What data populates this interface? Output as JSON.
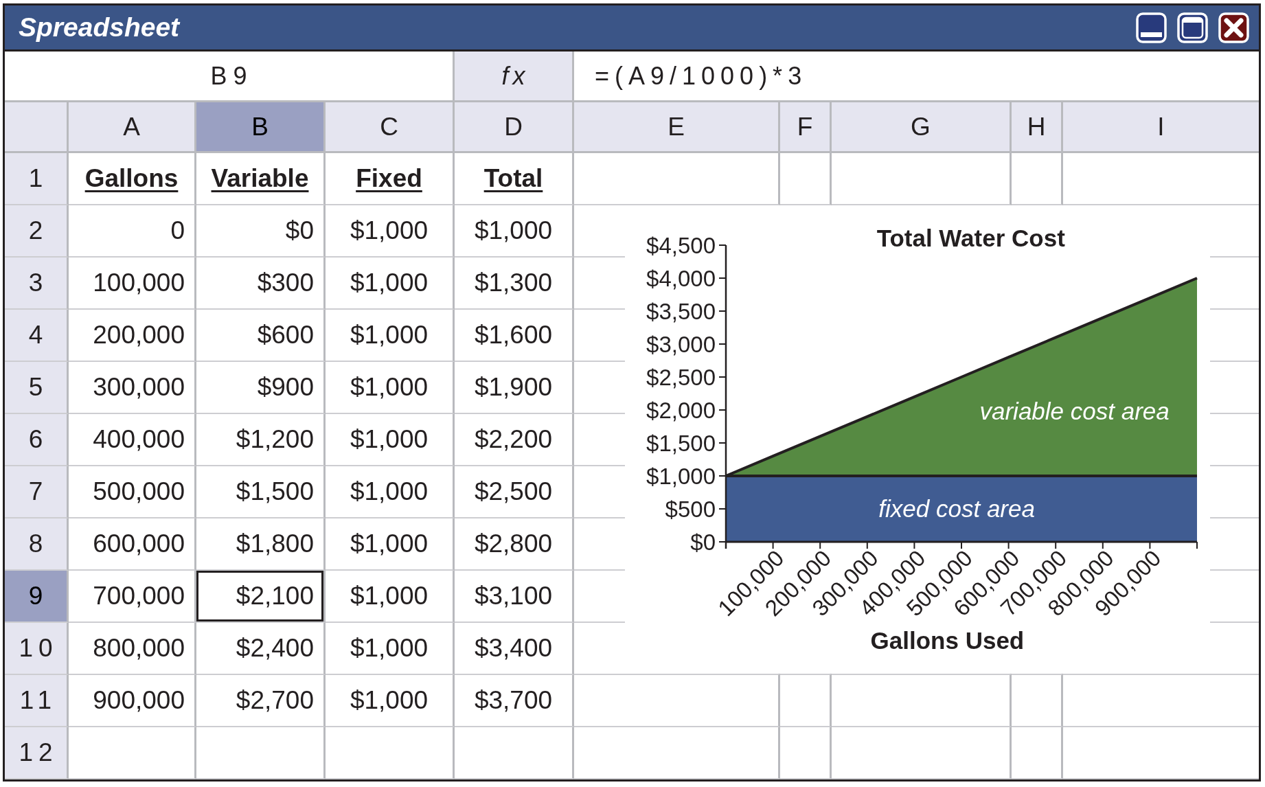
{
  "window": {
    "title": "Spreadsheet",
    "controls": [
      {
        "kind": "minimize"
      },
      {
        "kind": "maximize"
      },
      {
        "kind": "close"
      }
    ]
  },
  "formula_bar": {
    "cell_reference": "B9",
    "function_button": "fx",
    "formula": "=(A9/1000)*3"
  },
  "columns": [
    {
      "label": "A",
      "selected": false
    },
    {
      "label": "B",
      "selected": true
    },
    {
      "label": "C",
      "selected": false
    },
    {
      "label": "D",
      "selected": false
    },
    {
      "label": "E",
      "selected": false
    },
    {
      "label": "F",
      "selected": false
    },
    {
      "label": "G",
      "selected": false
    },
    {
      "label": "H",
      "selected": false
    },
    {
      "label": "I",
      "selected": false
    }
  ],
  "rows": [
    {
      "label": "1",
      "selected": false,
      "kind": "heading",
      "cells": [
        {
          "text": "Gallons",
          "selected": false
        },
        {
          "text": "Variable",
          "selected": false
        },
        {
          "text": "Fixed",
          "selected": false
        },
        {
          "text": "Total",
          "selected": false
        }
      ]
    },
    {
      "label": "2",
      "selected": false,
      "kind": "data",
      "cells": [
        {
          "text": "0",
          "selected": false
        },
        {
          "text": "$0",
          "selected": false
        },
        {
          "text": "$1,000",
          "selected": false
        },
        {
          "text": "$1,000",
          "selected": false
        }
      ]
    },
    {
      "label": "3",
      "selected": false,
      "kind": "data",
      "cells": [
        {
          "text": "100,000",
          "selected": false
        },
        {
          "text": "$300",
          "selected": false
        },
        {
          "text": "$1,000",
          "selected": false
        },
        {
          "text": "$1,300",
          "selected": false
        }
      ]
    },
    {
      "label": "4",
      "selected": false,
      "kind": "data",
      "cells": [
        {
          "text": "200,000",
          "selected": false
        },
        {
          "text": "$600",
          "selected": false
        },
        {
          "text": "$1,000",
          "selected": false
        },
        {
          "text": "$1,600",
          "selected": false
        }
      ]
    },
    {
      "label": "5",
      "selected": false,
      "kind": "data",
      "cells": [
        {
          "text": "300,000",
          "selected": false
        },
        {
          "text": "$900",
          "selected": false
        },
        {
          "text": "$1,000",
          "selected": false
        },
        {
          "text": "$1,900",
          "selected": false
        }
      ]
    },
    {
      "label": "6",
      "selected": false,
      "kind": "data",
      "cells": [
        {
          "text": "400,000",
          "selected": false
        },
        {
          "text": "$1,200",
          "selected": false
        },
        {
          "text": "$1,000",
          "selected": false
        },
        {
          "text": "$2,200",
          "selected": false
        }
      ]
    },
    {
      "label": "7",
      "selected": false,
      "kind": "data",
      "cells": [
        {
          "text": "500,000",
          "selected": false
        },
        {
          "text": "$1,500",
          "selected": false
        },
        {
          "text": "$1,000",
          "selected": false
        },
        {
          "text": "$2,500",
          "selected": false
        }
      ]
    },
    {
      "label": "8",
      "selected": false,
      "kind": "data",
      "cells": [
        {
          "text": "600,000",
          "selected": false
        },
        {
          "text": "$1,800",
          "selected": false
        },
        {
          "text": "$1,000",
          "selected": false
        },
        {
          "text": "$2,800",
          "selected": false
        }
      ]
    },
    {
      "label": "9",
      "selected": true,
      "kind": "data",
      "cells": [
        {
          "text": "700,000",
          "selected": false
        },
        {
          "text": "$2,100",
          "selected": true
        },
        {
          "text": "$1,000",
          "selected": false
        },
        {
          "text": "$3,100",
          "selected": false
        }
      ]
    },
    {
      "label": "10",
      "selected": false,
      "kind": "data",
      "cells": [
        {
          "text": "800,000",
          "selected": false
        },
        {
          "text": "$2,400",
          "selected": false
        },
        {
          "text": "$1,000",
          "selected": false
        },
        {
          "text": "$3,400",
          "selected": false
        }
      ]
    },
    {
      "label": "11",
      "selected": false,
      "kind": "data",
      "cells": [
        {
          "text": "900,000",
          "selected": false
        },
        {
          "text": "$2,700",
          "selected": false
        },
        {
          "text": "$1,000",
          "selected": false
        },
        {
          "text": "$3,700",
          "selected": false
        }
      ]
    },
    {
      "label": "12",
      "selected": false
    }
  ],
  "chart": {
    "chart_data": {
      "type": "area",
      "title": "Total Water Cost",
      "xlabel": "Gallons Used",
      "x": [
        0,
        100000,
        200000,
        300000,
        400000,
        500000,
        600000,
        700000,
        800000,
        900000,
        1000000
      ],
      "series": [
        {
          "color": "#405c92",
          "values": [
            1000,
            1000,
            1000,
            1000,
            1000,
            1000,
            1000,
            1000,
            1000,
            1000,
            1000
          ]
        },
        {
          "color": "#568a42",
          "values": [
            0,
            300,
            600,
            900,
            1200,
            1500,
            1800,
            2100,
            2400,
            2700,
            3000
          ]
        }
      ],
      "stacked": true,
      "xlim": [
        0,
        1000000
      ],
      "ylim": [
        0,
        4500
      ],
      "xticks": [
        {
          "value": 100000,
          "label": "100,000"
        },
        {
          "value": 200000,
          "label": "200,000"
        },
        {
          "value": 300000,
          "label": "300,000"
        },
        {
          "value": 400000,
          "label": "400,000"
        },
        {
          "value": 500000,
          "label": "500,000"
        },
        {
          "value": 600000,
          "label": "600,000"
        },
        {
          "value": 700000,
          "label": "700,000"
        },
        {
          "value": 800000,
          "label": "800,000"
        },
        {
          "value": 900000,
          "label": "900,000"
        }
      ],
      "yticks": [
        {
          "value": 0,
          "label": "$0"
        },
        {
          "value": 500,
          "label": "$500"
        },
        {
          "value": 1000,
          "label": "$1,000"
        },
        {
          "value": 1500,
          "label": "$1,500"
        },
        {
          "value": 2000,
          "label": "$2,000"
        },
        {
          "value": 2500,
          "label": "$2,500"
        },
        {
          "value": 3000,
          "label": "$3,000"
        },
        {
          "value": 3500,
          "label": "$3,500"
        },
        {
          "value": 4000,
          "label": "$4,000"
        },
        {
          "value": 4500,
          "label": "$4,500"
        }
      ],
      "annotations": [
        "variable cost area",
        "fixed cost area"
      ]
    }
  }
}
